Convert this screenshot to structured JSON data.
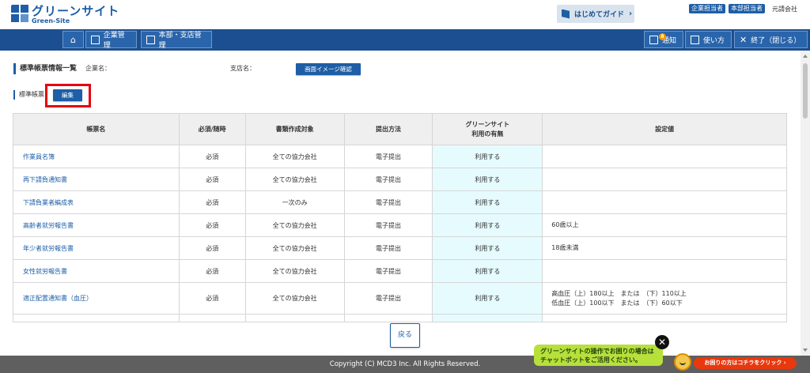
{
  "header": {
    "logo_jp": "グリーンサイト",
    "logo_en": "Green-Site",
    "guide_label": "はじめてガイド",
    "guide_chevron": "›",
    "tags": [
      "企業担当者",
      "本部担当者"
    ],
    "company": "元請会社"
  },
  "nav": {
    "home_icon": "⌂",
    "company_mgmt": "企業管理",
    "branch_mgmt": "本部・支店管理",
    "notice": "通知",
    "notice_count": "8",
    "howto": "使い方",
    "exit": "終了（閉じる）",
    "exit_icon": "✕"
  },
  "page": {
    "title": "標準帳票情報一覧",
    "company_label": "企業名：",
    "branch_label": "支店名：",
    "screen_button": "画面イメージ確認",
    "section_label": "標準帳票",
    "edit_button": "編集",
    "back_button": "戻る"
  },
  "table": {
    "headers": [
      "帳票名",
      "必須/随時",
      "書類作成対象",
      "提出方法",
      "グリーンサイト\n利用の有無",
      "設定値"
    ],
    "rows": [
      {
        "name": "作業員名簿",
        "req": "必須",
        "target": "全ての協力会社",
        "method": "電子提出",
        "use": "利用する",
        "setting": ""
      },
      {
        "name": "再下請負通知書",
        "req": "必須",
        "target": "全ての協力会社",
        "method": "電子提出",
        "use": "利用する",
        "setting": ""
      },
      {
        "name": "下請負業者編成表",
        "req": "必須",
        "target": "一次のみ",
        "method": "電子提出",
        "use": "利用する",
        "setting": ""
      },
      {
        "name": "高齢者就労報告書",
        "req": "必須",
        "target": "全ての協力会社",
        "method": "電子提出",
        "use": "利用する",
        "setting": "60歳以上"
      },
      {
        "name": "年少者就労報告書",
        "req": "必須",
        "target": "全ての協力会社",
        "method": "電子提出",
        "use": "利用する",
        "setting": "18歳未満"
      },
      {
        "name": "女性就労報告書",
        "req": "必須",
        "target": "全ての協力会社",
        "method": "電子提出",
        "use": "利用する",
        "setting": ""
      },
      {
        "name": "適正配置通知書（血圧）",
        "req": "必須",
        "target": "全ての協力会社",
        "method": "電子提出",
        "use": "利用する",
        "setting": "高血圧（上）180以上　または　（下）110以上\n低血圧（上）100以下　または　（下）60以下"
      }
    ]
  },
  "footer": {
    "copyright": "Copyright (C) MCD3 Inc. All Rights Reserved.",
    "chat_text": "グリーンサイトの操作でお困りの場合は\nチャットボットをご活用ください。",
    "chat_close": "✕",
    "cta": "お困りの方はコチラをクリック ›"
  }
}
